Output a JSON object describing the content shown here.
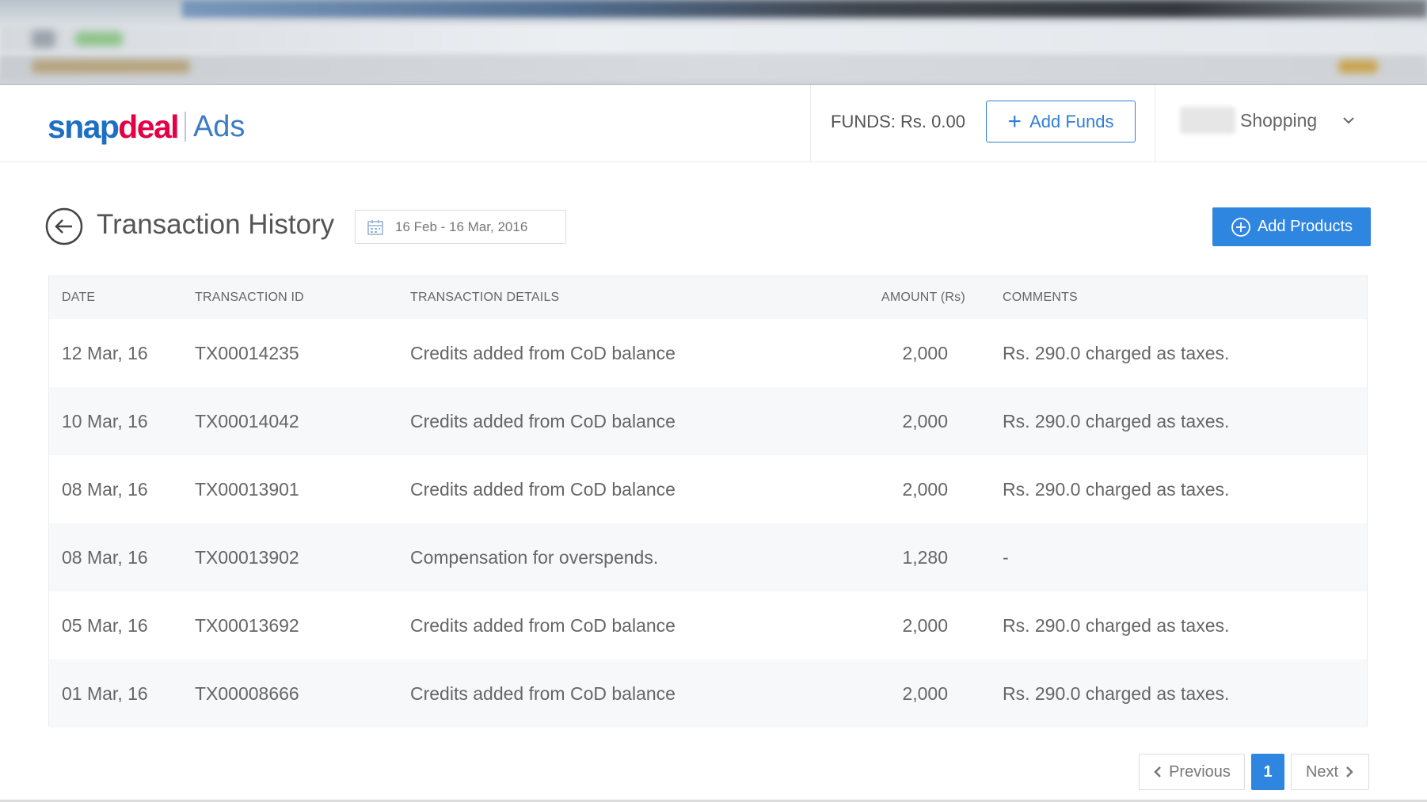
{
  "header": {
    "logo_text": "snapdeal",
    "logo_sub": "Ads",
    "funds_label": "FUNDS: Rs. 0.00",
    "add_funds_label": "Add Funds",
    "account_name": "Shopping"
  },
  "page": {
    "title": "Transaction History",
    "date_range": "16 Feb - 16 Mar, 2016",
    "add_products_label": "Add Products"
  },
  "table": {
    "columns": [
      "DATE",
      "TRANSACTION ID",
      "TRANSACTION DETAILS",
      "AMOUNT (Rs)",
      "COMMENTS"
    ],
    "rows": [
      {
        "date": "12 Mar, 16",
        "id": "TX00014235",
        "details": "Credits added from CoD balance",
        "amount": "2,000",
        "comment": "Rs. 290.0 charged as taxes."
      },
      {
        "date": "10 Mar, 16",
        "id": "TX00014042",
        "details": "Credits added from CoD balance",
        "amount": "2,000",
        "comment": "Rs. 290.0 charged as taxes."
      },
      {
        "date": "08 Mar, 16",
        "id": "TX00013901",
        "details": "Credits added from CoD balance",
        "amount": "2,000",
        "comment": "Rs. 290.0 charged as taxes."
      },
      {
        "date": "08 Mar, 16",
        "id": "TX00013902",
        "details": "Compensation for overspends.",
        "amount": "1,280",
        "comment": "-"
      },
      {
        "date": "05 Mar, 16",
        "id": "TX00013692",
        "details": "Credits added from CoD balance",
        "amount": "2,000",
        "comment": "Rs. 290.0 charged as taxes."
      },
      {
        "date": "01 Mar, 16",
        "id": "TX00008666",
        "details": "Credits added from CoD balance",
        "amount": "2,000",
        "comment": "Rs. 290.0 charged as taxes."
      }
    ]
  },
  "pagination": {
    "previous_label": "Previous",
    "current_page": "1",
    "next_label": "Next"
  },
  "colors": {
    "brand_blue": "#2f86e0",
    "logo_red": "#e40046",
    "logo_blue": "#1d6fc4"
  },
  "icons": [
    "back-arrow-icon",
    "calendar-icon",
    "plus-icon",
    "plus-circle-icon",
    "chevron-down-icon",
    "chevron-left-icon",
    "chevron-right-icon"
  ]
}
